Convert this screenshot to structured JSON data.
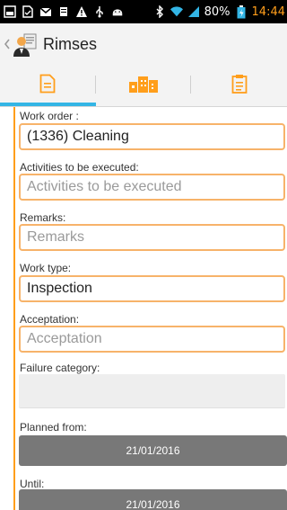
{
  "status_bar": {
    "battery_percent": "80%",
    "time": "14:44",
    "icons": [
      "screenshot-icon",
      "document-icon",
      "gmail-icon",
      "storage-icon",
      "warning-icon",
      "usb-icon",
      "android-debug-icon",
      "bluetooth-icon",
      "wifi-icon",
      "signal-icon",
      "battery-icon"
    ]
  },
  "action_bar": {
    "title": "Rimses"
  },
  "tabs": [
    {
      "name": "form",
      "icon": "document-icon",
      "selected": true
    },
    {
      "name": "locations",
      "icon": "buildings-icon",
      "selected": false
    },
    {
      "name": "checklist",
      "icon": "clipboard-icon",
      "selected": false
    }
  ],
  "form": {
    "work_order": {
      "label": "Work order :",
      "value": "(1336) Cleaning"
    },
    "activities": {
      "label": "Activities to be executed:",
      "placeholder": "Activities to be executed"
    },
    "remarks": {
      "label": "Remarks:",
      "placeholder": "Remarks"
    },
    "work_type": {
      "label": "Work type:",
      "value": "Inspection"
    },
    "acceptation": {
      "label": "Acceptation:",
      "placeholder": "Acceptation"
    },
    "failure_category": {
      "label": "Failure category:",
      "value": ""
    },
    "planned_from": {
      "label": "Planned from:",
      "value": "21/01/2016"
    },
    "until": {
      "label": "Until:",
      "value": "21/01/2016"
    }
  },
  "colors": {
    "accent": "#ff9e1b",
    "field_border": "#f7b36a",
    "tab_indicator": "#33b5e5",
    "date_button": "#787878"
  }
}
